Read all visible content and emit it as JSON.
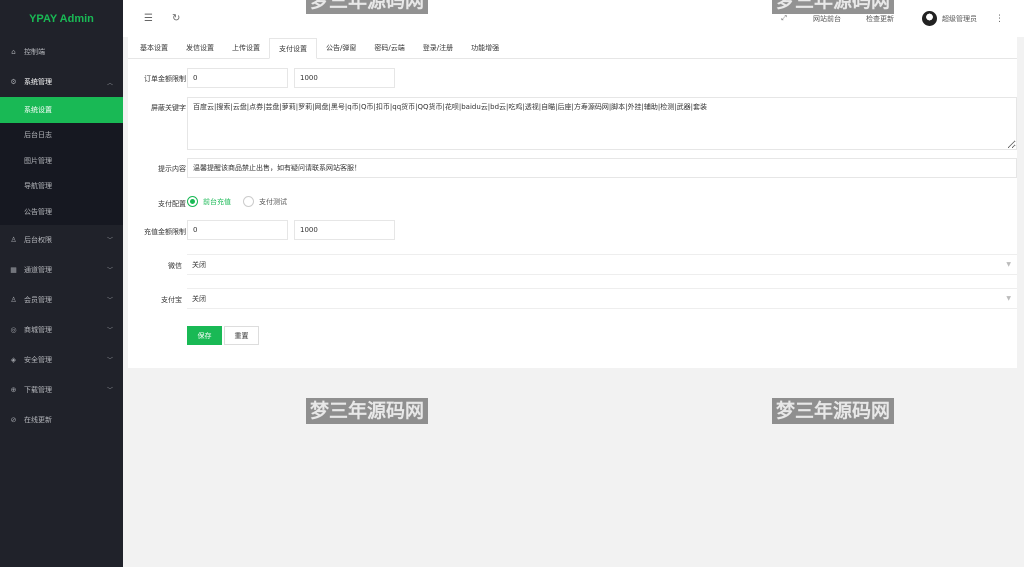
{
  "app": {
    "logo": "YPAY Admin"
  },
  "sidebar": {
    "items": [
      {
        "icon": "home-icon",
        "label": "控制端"
      },
      {
        "icon": "gear-icon",
        "label": "系统管理",
        "open": true,
        "children": [
          "系统设置",
          "后台日志",
          "图片管理",
          "导航管理",
          "公告管理"
        ]
      },
      {
        "icon": "user-icon",
        "label": "后台权限"
      },
      {
        "icon": "grid-icon",
        "label": "通道管理"
      },
      {
        "icon": "user-icon",
        "label": "会员管理"
      },
      {
        "icon": "shop-icon",
        "label": "商城管理"
      },
      {
        "icon": "shield-icon",
        "label": "安全管理"
      },
      {
        "icon": "download-icon",
        "label": "下载管理"
      },
      {
        "icon": "check-circle-icon",
        "label": "在线更新"
      }
    ],
    "active_child": "系统设置"
  },
  "header": {
    "links": [
      "网站前台",
      "检查更新"
    ],
    "user": "超级管理员"
  },
  "tabs": [
    "基本设置",
    "发信设置",
    "上传设置",
    "支付设置",
    "公告/弹窗",
    "密码/云端",
    "登录/注册",
    "功能增强"
  ],
  "active_tab": "支付设置",
  "form": {
    "order_limit": {
      "label": "订单金额限制",
      "min": "0",
      "max": "1000"
    },
    "keywords": {
      "label": "屏蔽关键字",
      "value": "百度云|搜索|云盘|点券|芸盘|萝莉|罗莉|网盘|黑号|q币|Q币|扣币|qq货币|QQ货币|花呗|baidu云|bd云|吃鸡|透视|自瞄|后座|方寿源码网|脚本|外挂|辅助|检测|武器|套装"
    },
    "tip": {
      "label": "提示内容",
      "value": "温馨提醒该商品禁止出售，如有疑问请联系网站客服！"
    },
    "pay_config": {
      "label": "支付配置",
      "options": [
        "前台充值",
        "支付测试"
      ],
      "selected": "前台充值"
    },
    "recharge_limit": {
      "label": "充值金额限制",
      "min": "0",
      "max": "1000"
    },
    "wechat": {
      "label": "微信",
      "value": "关闭"
    },
    "alipay": {
      "label": "支付宝",
      "value": "关闭"
    },
    "save": "保存",
    "reset": "重置"
  },
  "watermark": "梦三年源码网"
}
